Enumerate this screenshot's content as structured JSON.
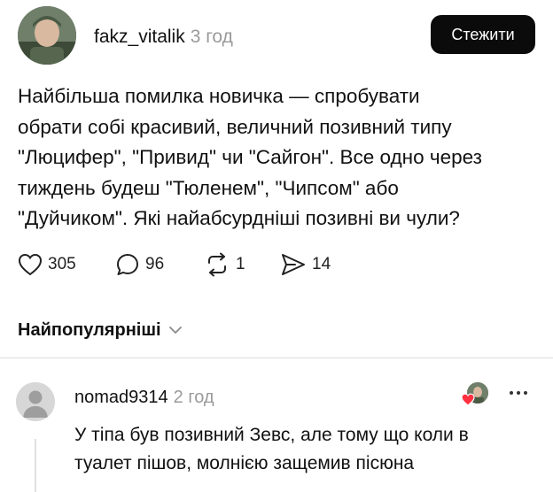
{
  "post": {
    "username": "fakz_vitalik",
    "time_ago": "3 год",
    "follow_label": "Стежити",
    "text": "Найбільша помилка новичка — спробувати\nобрати собі красивий, величний позивний типу\n\"Люцифер\", \"Привид\" чи \"Сайгон\". Все одно через\nтиждень будеш \"Тюленем\", \"Чипсом\" або\n\"Дуйчиком\". Які найабсурдніші позивні ви чули?",
    "likes": "305",
    "comments": "96",
    "reposts": "1",
    "shares": "14"
  },
  "sort": {
    "label": "Найпопулярніші"
  },
  "comment": {
    "username": "nomad9314",
    "time_ago": "2 год",
    "text": "У тіпа був позивний Зевс, але тому що коли в\nтуалет пішов, молнією защемив пісюна"
  },
  "icons": {
    "like": "heart-icon",
    "comment": "comment-icon",
    "repost": "repost-icon",
    "share": "share-icon",
    "sort": "chevron-down-icon",
    "more": "more-icon",
    "liked_by": "heart-icon"
  },
  "colors": {
    "follow_bg": "#0b0b0b",
    "heart": "#ff3040",
    "muted": "#9a9a9a"
  }
}
